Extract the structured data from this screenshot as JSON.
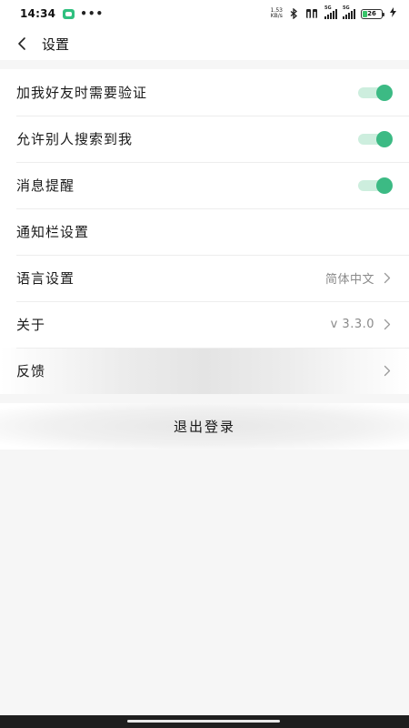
{
  "status_bar": {
    "time": "14:34",
    "dots": "•••",
    "speed_value": "1.53",
    "speed_unit": "KB/s",
    "network_label_1": "5G",
    "network_label_2": "5G",
    "battery_level": "26",
    "battery_fraction": 0.26
  },
  "header": {
    "title": "设置"
  },
  "settings": {
    "items": [
      {
        "label": "加我好友时需要验证",
        "type": "toggle",
        "on": true
      },
      {
        "label": "允许别人搜索到我",
        "type": "toggle",
        "on": true
      },
      {
        "label": "消息提醒",
        "type": "toggle",
        "on": true
      },
      {
        "label": "通知栏设置",
        "type": "plain"
      },
      {
        "label": "语言设置",
        "value": "简体中文",
        "type": "nav"
      },
      {
        "label": "关于",
        "value": "v 3.3.0",
        "type": "nav"
      },
      {
        "label": "反馈",
        "type": "nav"
      }
    ]
  },
  "logout": {
    "label": "退出登录"
  },
  "colors": {
    "toggle_on": "#3cba84",
    "toggle_track": "#cdeede",
    "background": "#f6f6f6"
  }
}
